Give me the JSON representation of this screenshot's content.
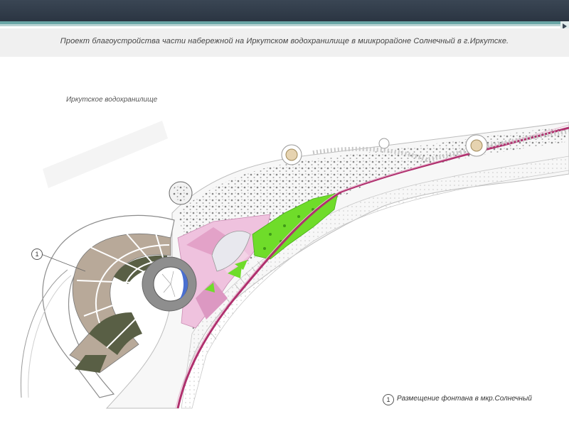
{
  "slide": {
    "title": "Проект благоустройства части набережной на Иркутском водохранилище в миикрорайоне Солнечный в г.Иркутске."
  },
  "map": {
    "water_label": "Иркутское водохранилище",
    "callout_number": "1"
  },
  "legend": {
    "number": "1",
    "text": "Размещение фонтана в мкр.Солнечный"
  },
  "colors": {
    "header": "#2f3a47",
    "accent": "#6aa6a6",
    "road": "#b0306e",
    "lawn": "#6fdc2a",
    "plaza_tan": "#b8a999",
    "plaza_dark": "#595f45",
    "pink_zone": "#e8a6cc",
    "fountain_blue": "#4a6fd0"
  }
}
